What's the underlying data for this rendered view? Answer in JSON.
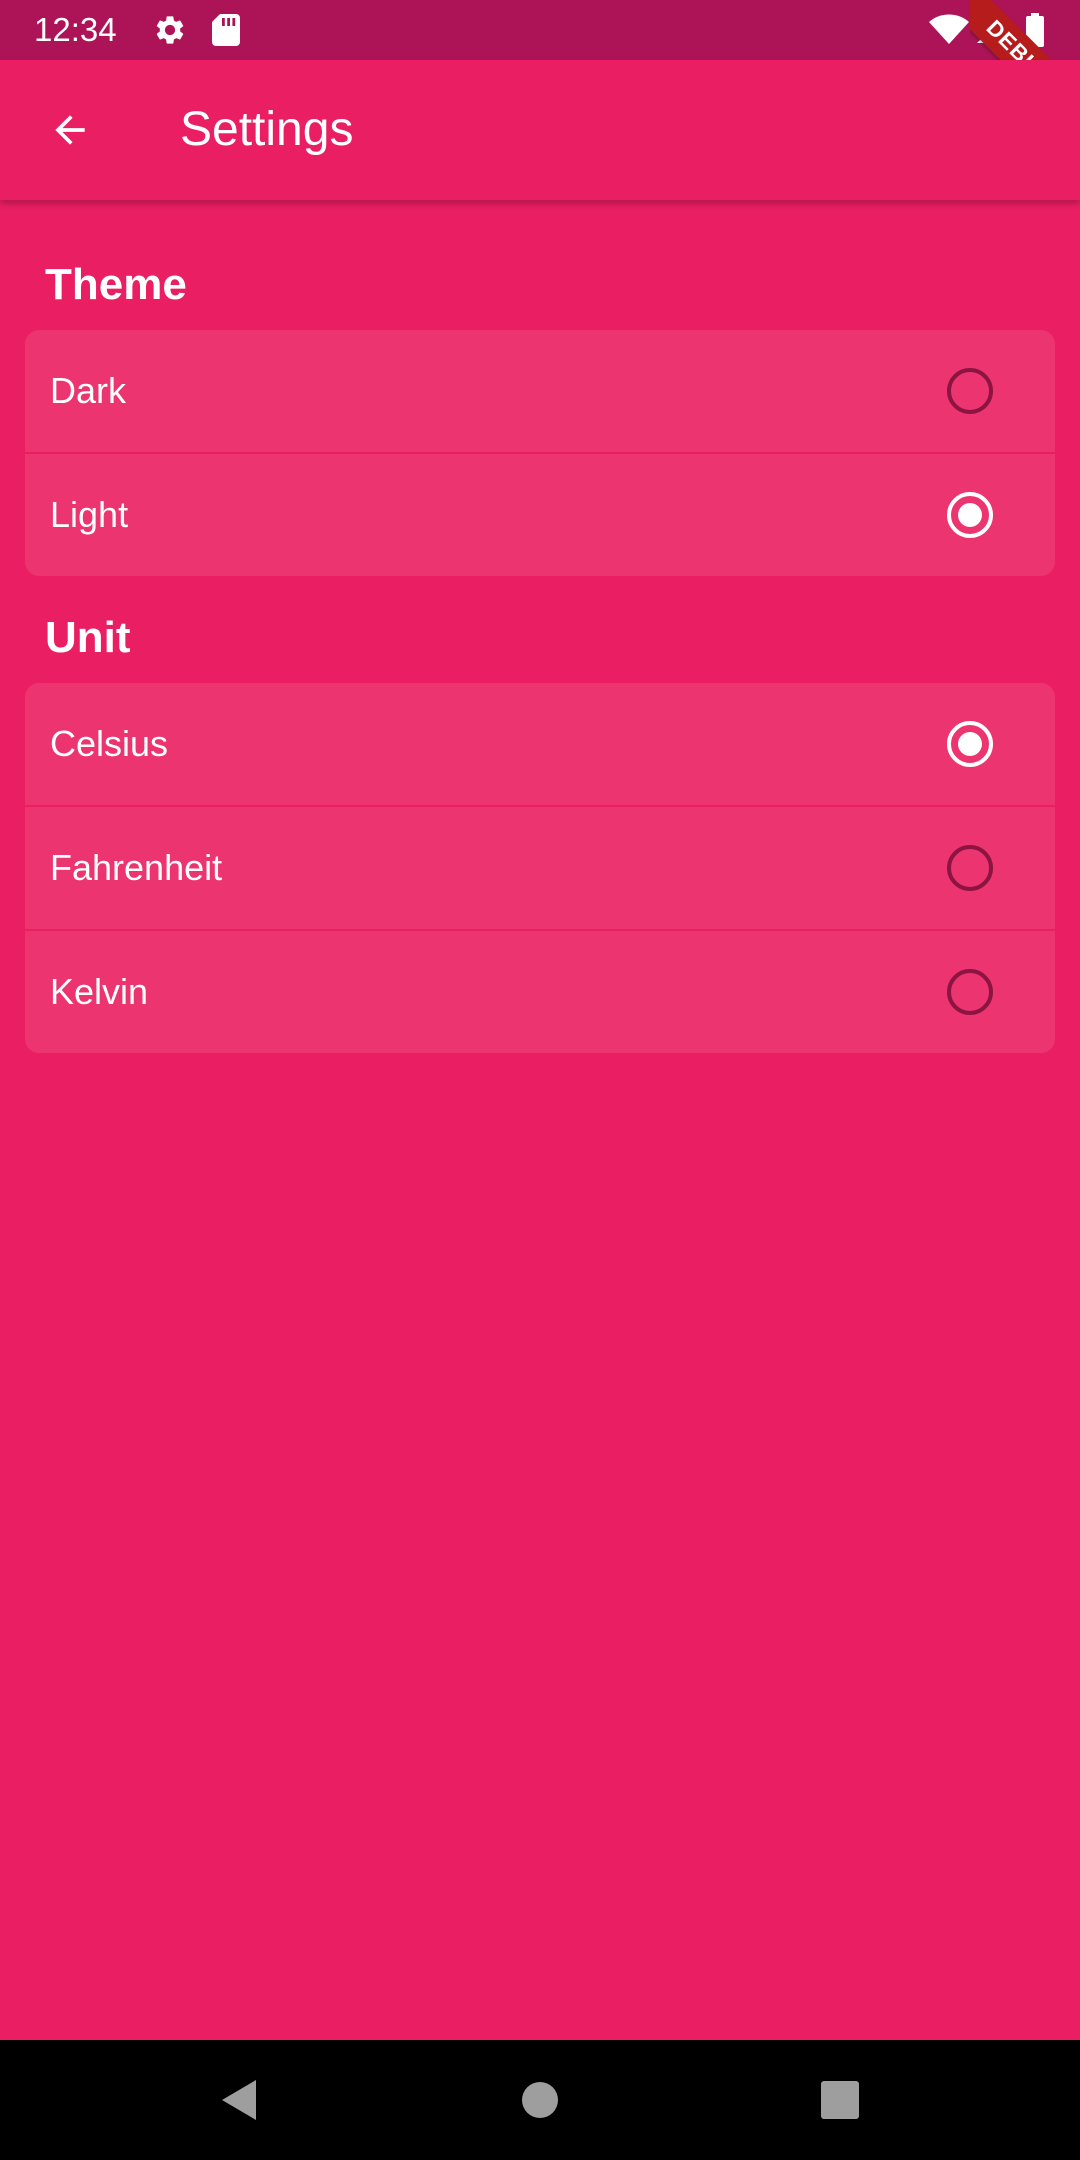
{
  "status_bar": {
    "time": "12:34",
    "icons": [
      "settings-icon",
      "sd-card-icon",
      "wifi-icon",
      "cell-signal-icon",
      "battery-icon"
    ]
  },
  "debug_banner": {
    "label": "DEBUG"
  },
  "app_bar": {
    "back_icon": "arrow-back-icon",
    "title": "Settings"
  },
  "theme_section": {
    "title": "Theme",
    "options": [
      {
        "label": "Dark",
        "selected": false
      },
      {
        "label": "Light",
        "selected": true
      }
    ]
  },
  "unit_section": {
    "title": "Unit",
    "options": [
      {
        "label": "Celsius",
        "selected": true
      },
      {
        "label": "Fahrenheit",
        "selected": false
      },
      {
        "label": "Kelvin",
        "selected": false
      }
    ]
  },
  "nav_bar": {
    "icons": [
      "back-triangle-icon",
      "home-circle-icon",
      "recents-square-icon"
    ]
  },
  "colors": {
    "background": "#e91e63",
    "status_bar": "#ad1457",
    "card": "#ec3470",
    "radio_unselected": "#8c1440",
    "radio_selected": "#ffffff",
    "debug_ribbon": "#b71c1c",
    "nav_bar": "#000000"
  }
}
